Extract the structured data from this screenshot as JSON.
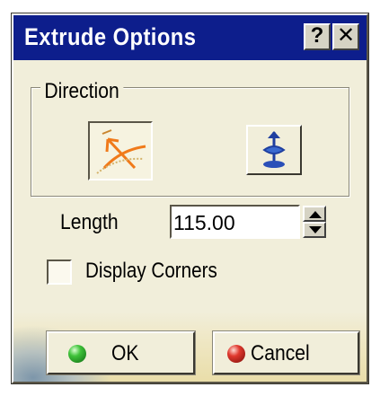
{
  "window": {
    "title": "Extrude Options",
    "help_label": "?",
    "close_label": "✕"
  },
  "direction": {
    "legend": "Direction",
    "buttons": [
      {
        "icon": "extrude-direction-icon",
        "pressed": true
      },
      {
        "icon": "normal-direction-icon",
        "pressed": false
      }
    ]
  },
  "length": {
    "label": "Length",
    "value": "115.00"
  },
  "display_corners": {
    "label": "Display Corners",
    "checked": false
  },
  "actions": {
    "ok_label": "OK",
    "cancel_label": "Cancel"
  },
  "colors": {
    "titlebar": "#0d1e8c",
    "dialog_bg": "#f1eeda",
    "icon_orange": "#f07a1a",
    "icon_blue": "#1f3fa0",
    "ok_green": "#3fc23a",
    "cancel_red": "#e0392e"
  }
}
